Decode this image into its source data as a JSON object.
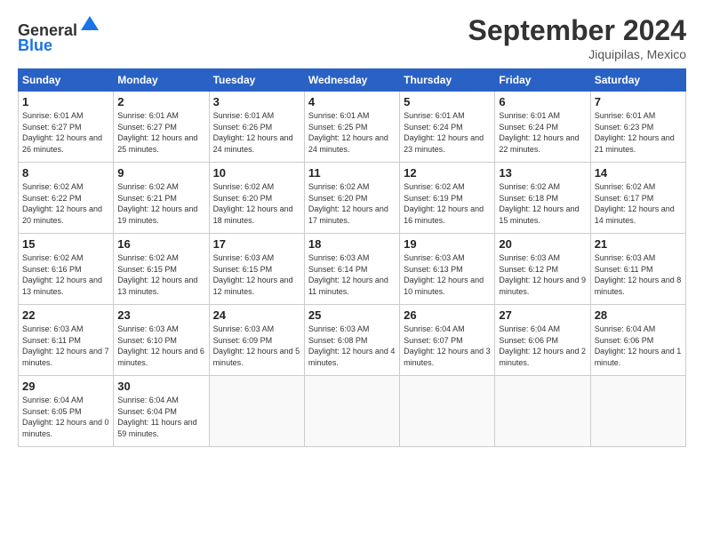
{
  "header": {
    "logo_line1": "General",
    "logo_line2": "Blue",
    "title": "September 2024",
    "location": "Jiquipilas, Mexico"
  },
  "calendar": {
    "columns": [
      "Sunday",
      "Monday",
      "Tuesday",
      "Wednesday",
      "Thursday",
      "Friday",
      "Saturday"
    ],
    "weeks": [
      [
        {
          "day": "",
          "sunrise": "",
          "sunset": "",
          "daylight": ""
        },
        {
          "day": "2",
          "sunrise": "6:01 AM",
          "sunset": "6:27 PM",
          "daylight": "12 hours and 25 minutes."
        },
        {
          "day": "3",
          "sunrise": "6:01 AM",
          "sunset": "6:26 PM",
          "daylight": "12 hours and 24 minutes."
        },
        {
          "day": "4",
          "sunrise": "6:01 AM",
          "sunset": "6:25 PM",
          "daylight": "12 hours and 24 minutes."
        },
        {
          "day": "5",
          "sunrise": "6:01 AM",
          "sunset": "6:24 PM",
          "daylight": "12 hours and 23 minutes."
        },
        {
          "day": "6",
          "sunrise": "6:01 AM",
          "sunset": "6:24 PM",
          "daylight": "12 hours and 22 minutes."
        },
        {
          "day": "7",
          "sunrise": "6:01 AM",
          "sunset": "6:23 PM",
          "daylight": "12 hours and 21 minutes."
        }
      ],
      [
        {
          "day": "1",
          "sunrise": "6:01 AM",
          "sunset": "6:27 PM",
          "daylight": "12 hours and 26 minutes.",
          "first_in_col": true
        },
        {
          "day": "9",
          "sunrise": "6:02 AM",
          "sunset": "6:21 PM",
          "daylight": "12 hours and 19 minutes."
        },
        {
          "day": "10",
          "sunrise": "6:02 AM",
          "sunset": "6:20 PM",
          "daylight": "12 hours and 18 minutes."
        },
        {
          "day": "11",
          "sunrise": "6:02 AM",
          "sunset": "6:20 PM",
          "daylight": "12 hours and 17 minutes."
        },
        {
          "day": "12",
          "sunrise": "6:02 AM",
          "sunset": "6:19 PM",
          "daylight": "12 hours and 16 minutes."
        },
        {
          "day": "13",
          "sunrise": "6:02 AM",
          "sunset": "6:18 PM",
          "daylight": "12 hours and 15 minutes."
        },
        {
          "day": "14",
          "sunrise": "6:02 AM",
          "sunset": "6:17 PM",
          "daylight": "12 hours and 14 minutes."
        }
      ],
      [
        {
          "day": "8",
          "sunrise": "6:02 AM",
          "sunset": "6:22 PM",
          "daylight": "12 hours and 20 minutes."
        },
        {
          "day": "16",
          "sunrise": "6:02 AM",
          "sunset": "6:15 PM",
          "daylight": "12 hours and 13 minutes."
        },
        {
          "day": "17",
          "sunrise": "6:03 AM",
          "sunset": "6:15 PM",
          "daylight": "12 hours and 12 minutes."
        },
        {
          "day": "18",
          "sunrise": "6:03 AM",
          "sunset": "6:14 PM",
          "daylight": "12 hours and 11 minutes."
        },
        {
          "day": "19",
          "sunrise": "6:03 AM",
          "sunset": "6:13 PM",
          "daylight": "12 hours and 10 minutes."
        },
        {
          "day": "20",
          "sunrise": "6:03 AM",
          "sunset": "6:12 PM",
          "daylight": "12 hours and 9 minutes."
        },
        {
          "day": "21",
          "sunrise": "6:03 AM",
          "sunset": "6:11 PM",
          "daylight": "12 hours and 8 minutes."
        }
      ],
      [
        {
          "day": "15",
          "sunrise": "6:02 AM",
          "sunset": "6:16 PM",
          "daylight": "12 hours and 13 minutes."
        },
        {
          "day": "23",
          "sunrise": "6:03 AM",
          "sunset": "6:10 PM",
          "daylight": "12 hours and 6 minutes."
        },
        {
          "day": "24",
          "sunrise": "6:03 AM",
          "sunset": "6:09 PM",
          "daylight": "12 hours and 5 minutes."
        },
        {
          "day": "25",
          "sunrise": "6:03 AM",
          "sunset": "6:08 PM",
          "daylight": "12 hours and 4 minutes."
        },
        {
          "day": "26",
          "sunrise": "6:04 AM",
          "sunset": "6:07 PM",
          "daylight": "12 hours and 3 minutes."
        },
        {
          "day": "27",
          "sunrise": "6:04 AM",
          "sunset": "6:06 PM",
          "daylight": "12 hours and 2 minutes."
        },
        {
          "day": "28",
          "sunrise": "6:04 AM",
          "sunset": "6:06 PM",
          "daylight": "12 hours and 1 minute."
        }
      ],
      [
        {
          "day": "22",
          "sunrise": "6:03 AM",
          "sunset": "6:11 PM",
          "daylight": "12 hours and 7 minutes."
        },
        {
          "day": "30",
          "sunrise": "6:04 AM",
          "sunset": "6:04 PM",
          "daylight": "11 hours and 59 minutes."
        },
        {
          "day": "",
          "sunrise": "",
          "sunset": "",
          "daylight": ""
        },
        {
          "day": "",
          "sunrise": "",
          "sunset": "",
          "daylight": ""
        },
        {
          "day": "",
          "sunrise": "",
          "sunset": "",
          "daylight": ""
        },
        {
          "day": "",
          "sunrise": "",
          "sunset": "",
          "daylight": ""
        },
        {
          "day": "",
          "sunrise": "",
          "sunset": "",
          "daylight": ""
        }
      ],
      [
        {
          "day": "29",
          "sunrise": "6:04 AM",
          "sunset": "6:05 PM",
          "daylight": "12 hours and 0 minutes."
        },
        {
          "day": "",
          "sunrise": "",
          "sunset": "",
          "daylight": ""
        },
        {
          "day": "",
          "sunrise": "",
          "sunset": "",
          "daylight": ""
        },
        {
          "day": "",
          "sunrise": "",
          "sunset": "",
          "daylight": ""
        },
        {
          "day": "",
          "sunrise": "",
          "sunset": "",
          "daylight": ""
        },
        {
          "day": "",
          "sunrise": "",
          "sunset": "",
          "daylight": ""
        },
        {
          "day": "",
          "sunrise": "",
          "sunset": "",
          "daylight": ""
        }
      ]
    ]
  },
  "labels": {
    "sunrise_prefix": "Sunrise: ",
    "sunset_prefix": "Sunset: ",
    "daylight_prefix": "Daylight: "
  }
}
